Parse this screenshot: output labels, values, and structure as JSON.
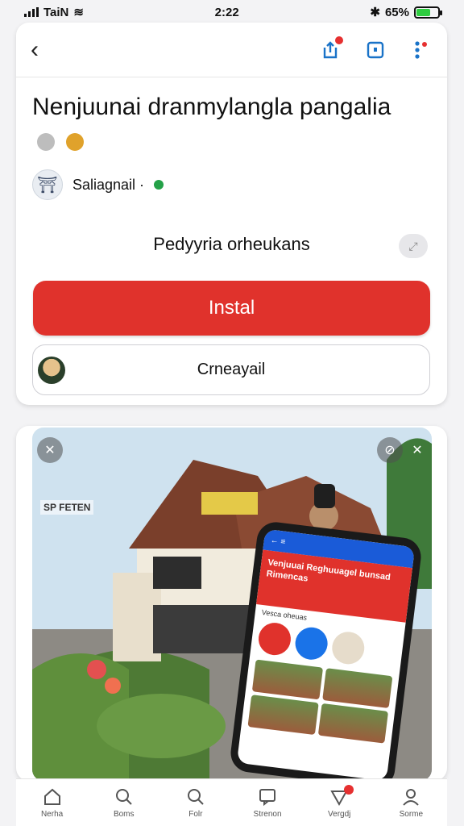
{
  "status_bar": {
    "carrier": "TaiN",
    "time": "2:22",
    "battery": "65%",
    "battery_level": 0.65
  },
  "header": {
    "back_icon": "chevron-left-icon",
    "actions": [
      "share-icon",
      "bookmark-icon",
      "more-icon"
    ]
  },
  "title": "Nenjuunai dranmylangla pangalia",
  "author": {
    "name": "Saliagnail ·",
    "verified": true
  },
  "subtitle": "Pedyyria orheukans",
  "buttons": {
    "install": "Instal",
    "secondary": "Crneayail"
  },
  "photo": {
    "overlay_text": "SP FETEN",
    "phone_screen_text": "Venjuuai Reghuuagel bunsad Rimencas",
    "phone_sub_text": "Vesca oheuas"
  },
  "tabs": [
    {
      "label": "Nerha",
      "icon": "home-icon"
    },
    {
      "label": "Boms",
      "icon": "search-icon"
    },
    {
      "label": "Folr",
      "icon": "search-icon"
    },
    {
      "label": "Strenon",
      "icon": "message-icon"
    },
    {
      "label": "Vergdj",
      "icon": "notification-icon"
    },
    {
      "label": "Sorme",
      "icon": "profile-icon"
    }
  ],
  "colors": {
    "accent": "#e0322c",
    "badge": "#e63030",
    "verified": "#24a148"
  }
}
